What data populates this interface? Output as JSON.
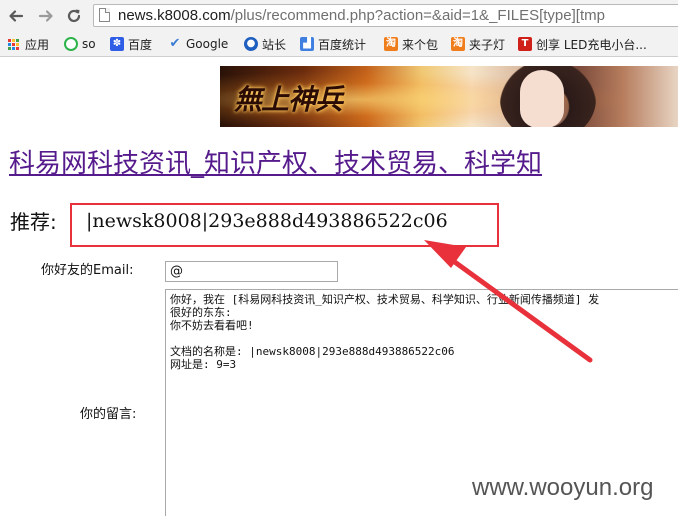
{
  "browser": {
    "url_host": "news.k8008.com",
    "url_path": "/plus/recommend.php?action=&aid=1&_FILES[type][tmp"
  },
  "bookmarks": [
    {
      "label": "应用",
      "icon": "apps-grid-icon"
    },
    {
      "label": "so",
      "icon": "so-search-icon"
    },
    {
      "label": "百度",
      "icon": "baidu-paw-icon"
    },
    {
      "label": "Google",
      "icon": "google-bird-icon"
    },
    {
      "label": "站长",
      "icon": "zhanzhang-icon"
    },
    {
      "label": "百度统计",
      "icon": "chart-icon"
    },
    {
      "label": "来个包",
      "icon": "taobao-icon"
    },
    {
      "label": "夹子灯",
      "icon": "taobao-icon"
    },
    {
      "label": "创享 LED充电小台...",
      "icon": "t-letter-icon"
    }
  ],
  "banner": {
    "title": "無上神兵"
  },
  "page": {
    "site_title": "科易网科技资讯_知识产权、技术贸易、科学知",
    "recommend_label": "推荐:",
    "recommend_value": "|newsk8008|293e888d493886522c06",
    "email_label": "你好友的Email:",
    "email_value": "@",
    "message_label": "你的留言:",
    "message_text": "你好，我在 [科易网科技资讯_知识产权、技术贸易、科学知识、行业新闻传播频道] 发\n很好的东东:\n你不妨去看看吧!\n\n文档的名称是: |newsk8008|293e888d493886522c06\n网址是: 9=3"
  },
  "watermark": "www.wooyun.org",
  "colors": {
    "visited_link": "#551a8b",
    "highlight_red": "#e8313a"
  }
}
